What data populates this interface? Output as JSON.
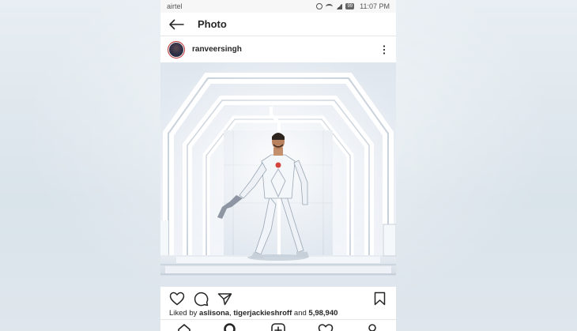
{
  "status_bar": {
    "carrier": "airtel",
    "battery": "99",
    "time": "11:07 PM"
  },
  "header": {
    "title": "Photo"
  },
  "post": {
    "username": "ranveersingh",
    "likes": {
      "prefix": "Liked by",
      "user1": "aslisona",
      "user2": "tigerjackieshroff",
      "connector": "and",
      "count": "5,98,940"
    }
  },
  "icons": {
    "back": "arrow-left-icon",
    "more": "more-vertical-icon",
    "like": "heart-icon",
    "comment": "comment-icon",
    "share": "send-icon",
    "save": "bookmark-icon",
    "nav": [
      "home-icon",
      "search-icon",
      "add-post-icon",
      "activity-heart-icon",
      "profile-icon"
    ]
  },
  "colors": {
    "text": "#262626",
    "avatar_ring": "#c53a3a",
    "page_background": "#dfe7ed"
  }
}
